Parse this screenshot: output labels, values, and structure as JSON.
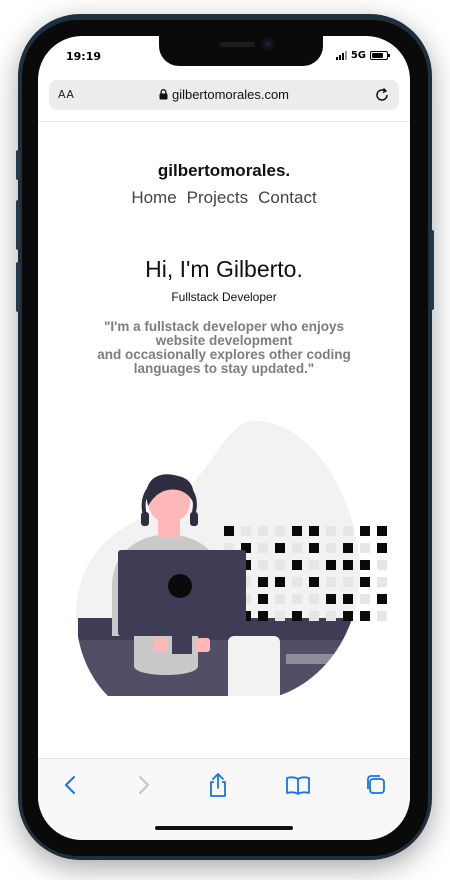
{
  "status_bar": {
    "time": "19:19",
    "network": "5G",
    "battery_level": 0.8
  },
  "address_bar": {
    "text_size_label": "AA",
    "url": "gilbertomorales.com"
  },
  "site": {
    "brand": "gilbertomorales.",
    "nav": [
      "Home",
      "Projects",
      "Contact"
    ],
    "hero_title": "Hi, I'm Gilberto.",
    "hero_subtitle": "Fullstack Developer",
    "quote_lines": [
      "\"I'm a fullstack developer who enjoys",
      "website development",
      "and occasionally explores other coding",
      "languages to stay updated.\""
    ]
  },
  "toolbar": {
    "buttons": [
      "back-icon",
      "forward-icon",
      "share-icon",
      "bookmarks-icon",
      "tabs-icon"
    ]
  },
  "colors": {
    "accent": "#1a73e8",
    "illustration_dark": "#3f3d56",
    "illustration_light": "#f2f2f2",
    "skin": "#ffb8b8"
  }
}
